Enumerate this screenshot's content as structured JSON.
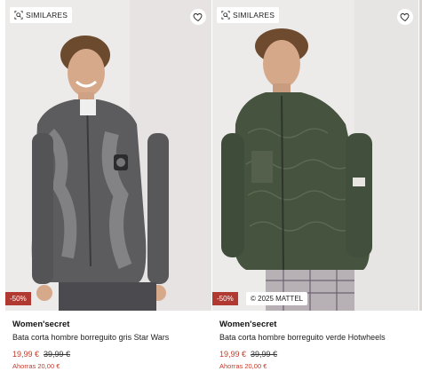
{
  "colors": {
    "discount": "#b03a32",
    "price": "#c43c2c"
  },
  "products": [
    {
      "similar_label": "SIMILARES",
      "discount": "-50%",
      "brand": "Women'secret",
      "name": "Bata corta hombre borreguito gris Star Wars",
      "price": "19,99 €",
      "old_price": "39,99 €",
      "savings": "Ahorras 20,00 €"
    },
    {
      "similar_label": "SIMILARES",
      "discount": "-50%",
      "copyright": "© 2025 MATTEL",
      "brand": "Women'secret",
      "name": "Bata corta hombre borreguito verde Hotwheels",
      "price": "19,99 €",
      "old_price": "39,99 €",
      "savings": "Ahorras 20,00 €"
    }
  ]
}
